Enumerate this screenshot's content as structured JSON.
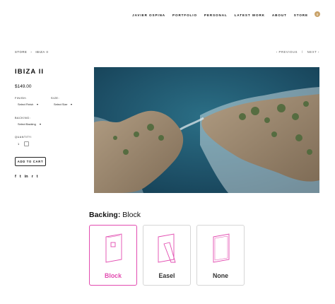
{
  "nav": {
    "items": [
      "JAVIER OSPINA",
      "PORTFOLIO",
      "PERSONAL",
      "LATEST WORK",
      "ABOUT",
      "STORE"
    ],
    "cart_count": "0"
  },
  "breadcrumb": {
    "store": "STORE",
    "sep": "›",
    "current": "IBIZA II"
  },
  "pager": {
    "prev": "‹ PREVIOUS",
    "sep": "/",
    "next": "NEXT ›"
  },
  "product": {
    "title": "IBIZA II",
    "price": "$149.00",
    "finish_label": "FINISH:",
    "finish_value": "Select Finish",
    "size_label": "SIZE:",
    "size_value": "Select Size",
    "backing_label": "BACKING:",
    "backing_value": "Select Backing",
    "quantity_label": "QUANTITY:",
    "quantity_value": "1",
    "add_to_cart": "ADD TO CART"
  },
  "social": {
    "facebook": "f",
    "twitter": "t",
    "linkedin": "in",
    "reddit": "r",
    "tumblr": "t"
  },
  "backing": {
    "heading": "Backing:",
    "selected": "Block",
    "options": [
      "Block",
      "Easel",
      "None"
    ],
    "accent_color": "#e24bb0"
  },
  "icons": {
    "cart": "cart-badge-icon",
    "block": "block-backing-icon",
    "easel": "easel-backing-icon",
    "none": "no-backing-icon"
  }
}
